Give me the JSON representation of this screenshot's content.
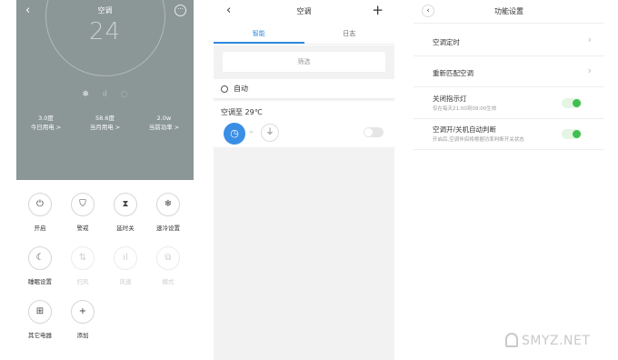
{
  "screen1": {
    "title": "空调",
    "back_glyph": "‹",
    "more_glyph": "···",
    "temperature": "24",
    "mode_icons": [
      "❄",
      "ıl",
      "◌"
    ],
    "stats": [
      {
        "value": "3.0度",
        "label": "今日用电 >"
      },
      {
        "value": "58.6度",
        "label": "当月用电 >"
      },
      {
        "value": "2.0w",
        "label": "当前功率 >"
      }
    ],
    "buttons": [
      {
        "label": "开启",
        "icon": "⏻"
      },
      {
        "label": "警戒",
        "icon": "⛉"
      },
      {
        "label": "延时关",
        "icon": "⧗"
      },
      {
        "label": "速冷设置",
        "icon": "❄"
      },
      {
        "label": "睡眠设置",
        "icon": "☾"
      },
      {
        "label": "扫风",
        "icon": "⇅"
      },
      {
        "label": "风速",
        "icon": "ıl"
      },
      {
        "label": "模式",
        "icon": "⧉"
      },
      {
        "label": "其它电器",
        "icon": "⊞"
      },
      {
        "label": "添加",
        "icon": "+"
      }
    ]
  },
  "screen2": {
    "title": "空调",
    "back_glyph": "‹",
    "add_glyph": "+",
    "tabs": [
      {
        "label": "智能"
      },
      {
        "label": "日志"
      }
    ],
    "filter_label": "筛选",
    "auto_label": "自动",
    "rule_text": "空调至 29℃",
    "rule_dots": "∞",
    "clock_icon": "◷",
    "plug_icon": "⏚"
  },
  "screen3": {
    "title": "功能设置",
    "back_glyph": "‹",
    "chevron_glyph": "›",
    "nav_rows": [
      {
        "label": "空调定时"
      },
      {
        "label": "重新匹配空调"
      }
    ],
    "switch_rows": [
      {
        "label": "关闭指示灯",
        "sub": "仅在每天21:00到09:00生效",
        "on": true
      },
      {
        "label": "空调开/关机自动判断",
        "sub": "开启后,空调伴侣将根据功率判断开关状态",
        "on": true
      }
    ]
  },
  "watermark": "SMYZ.NET",
  "colors": {
    "accent": "#2e8be0",
    "hero_bg": "#8b9697",
    "switch_on": "#3fbf4f"
  }
}
